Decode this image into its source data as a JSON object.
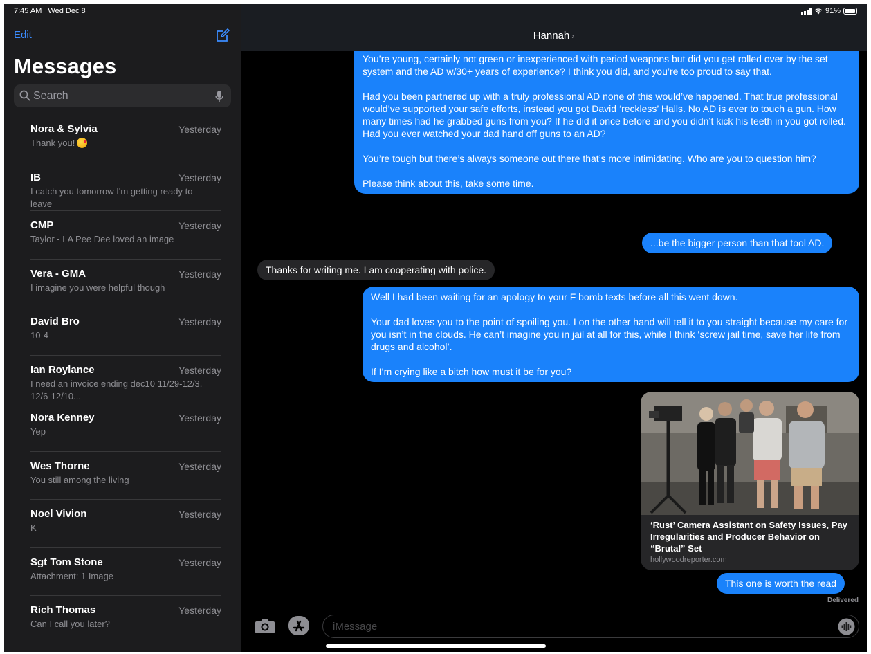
{
  "status_bar": {
    "time": "7:45 AM",
    "date": "Wed Dec 8",
    "battery": "91%",
    "battery_level": 0.91
  },
  "sidebar": {
    "edit_label": "Edit",
    "title": "Messages",
    "search_placeholder": "Search",
    "conversations": [
      {
        "name": "Nora & Sylvia",
        "time": "Yesterday",
        "preview": "Thank you!",
        "emoji": "winking-kiss-emoji"
      },
      {
        "name": "IB",
        "time": "Yesterday",
        "preview": "I catch you tomorrow I'm getting ready to leave"
      },
      {
        "name": "CMP",
        "time": "Yesterday",
        "preview": "Taylor - LA Pee Dee loved an image"
      },
      {
        "name": "Vera - GMA",
        "time": "Yesterday",
        "preview": "I imagine you were helpful though"
      },
      {
        "name": "David Bro",
        "time": "Yesterday",
        "preview": "10-4"
      },
      {
        "name": "Ian Roylance",
        "time": "Yesterday",
        "preview": "I need an invoice ending dec10 11/29-12/3. 12/6-12/10..."
      },
      {
        "name": "Nora Kenney",
        "time": "Yesterday",
        "preview": "Yep"
      },
      {
        "name": "Wes Thorne",
        "time": "Yesterday",
        "preview": "You still among the living"
      },
      {
        "name": "Noel Vivion",
        "time": "Yesterday",
        "preview": "K"
      },
      {
        "name": "Sgt Tom Stone",
        "time": "Yesterday",
        "preview": "Attachment: 1 Image"
      },
      {
        "name": "Rich Thomas",
        "time": "Yesterday",
        "preview": "Can I call you later?"
      }
    ]
  },
  "chat": {
    "contact_name": "Hannah",
    "messages": [
      {
        "direction": "outgoing",
        "paragraphs": [
          "You’re young, certainly not green or inexperienced with period weapons but did you get rolled over by the set system and the AD w/30+ years of experience? I think you did, and you’re too proud to say that.",
          "Had you been partnered up with a truly professional AD none of this would’ve happened. That true professional would’ve supported your safe efforts, instead you got David ‘reckless’ Halls. No AD is ever to touch a gun. How many times had he grabbed guns from you? If he did it once before and you didn’t kick his teeth in you got rolled. Had you ever watched your dad hand off guns to an AD?",
          "You’re tough but there’s always someone out there that’s more intimidating. Who are you to question him?",
          "Please think about this, take some time."
        ]
      },
      {
        "direction": "outgoing",
        "text": "...be the bigger person than that tool AD."
      },
      {
        "direction": "incoming",
        "text": "Thanks for writing me. I am cooperating with police."
      },
      {
        "direction": "outgoing",
        "paragraphs": [
          "Well I had been waiting for an apology to your F bomb texts before all this went down.",
          "Your dad loves you to the point of spoiling you. I on the other hand will tell it to you straight because my care for you isn’t in the clouds. He can’t imagine you in jail at all for this, while I think ‘screw jail time, save her life from drugs and alcohol’.",
          "If I’m crying like a bitch how must it be for you?"
        ]
      },
      {
        "direction": "outgoing",
        "link_preview": {
          "title": "‘Rust’ Camera Assistant on Safety Issues, Pay Irregularities and Producer Behavior on “Brutal” Set",
          "domain": "hollywoodreporter.com"
        }
      },
      {
        "direction": "outgoing",
        "text": "This one is worth the read"
      }
    ],
    "delivered_label": "Delivered",
    "input_placeholder": "iMessage"
  },
  "colors": {
    "outgoing_bubble": "#1a82fb",
    "incoming_bubble": "#262628",
    "accent": "#3b8cff",
    "sidebar_bg": "#1c1c1e"
  }
}
